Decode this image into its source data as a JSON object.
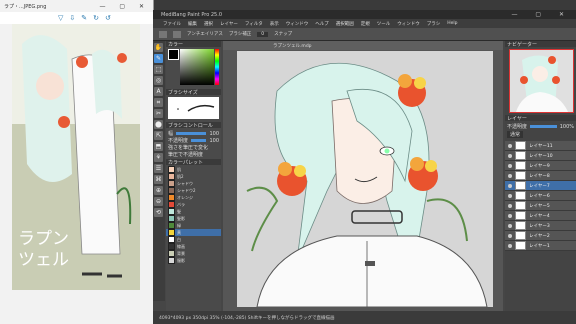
{
  "viewer": {
    "title": "ラプ・...JPEG.png",
    "tools": [
      "▽",
      "⇩",
      "✎",
      "↻",
      "↺"
    ],
    "poster_text": [
      "ラプン",
      "ツェル"
    ],
    "status_left": "",
    "status_right": ""
  },
  "app": {
    "title": "MediBang Paint Pro 25.0",
    "menu": [
      "ファイル",
      "編集",
      "選択",
      "レイヤー",
      "フィルタ",
      "表示",
      "ウィンドウ",
      "ヘルプ",
      "選択範囲",
      "定規",
      "ツール",
      "ウィンドウ",
      "ブラシ",
      "Help"
    ],
    "toolbar": {
      "antialias_label": "アンチエイリアス",
      "mode_label": "ブラシ補正",
      "value": "0",
      "snap_label": "スナップ"
    },
    "tab_label": "ラプンツェル.mdp",
    "tools": [
      "✋",
      "✎",
      "⬚",
      "◎",
      "A",
      "⌗",
      "✂",
      "⬤",
      "⇱",
      "⬒",
      "⚘",
      "☰",
      "⌘",
      "⊕",
      "⊖",
      "⟲"
    ],
    "color_panel": {
      "title": "カラー",
      "brush_size_title": "ブラシサイズ",
      "brush_control_title": "ブラシコントロール",
      "sliders": [
        {
          "label": "幅",
          "value": "100"
        },
        {
          "label": "不透明度",
          "value": "100"
        }
      ],
      "checks": [
        "強さを筆圧で変化",
        "筆圧で不透明度"
      ],
      "palette_title": "カラーパレット",
      "palette": [
        {
          "name": "肌",
          "color": "#f5d0b8"
        },
        {
          "name": "肌2",
          "color": "#e8b59c"
        },
        {
          "name": "シャドウ",
          "color": "#caa08a"
        },
        {
          "name": "シャドウ2",
          "color": "#8a6a5a"
        },
        {
          "name": "オレンジ",
          "color": "#f08a2a"
        },
        {
          "name": "バラ",
          "color": "#e24a38"
        },
        {
          "name": "髪",
          "color": "#bfe8dc"
        },
        {
          "name": "髪影",
          "color": "#8ec8b8"
        },
        {
          "name": "緑",
          "color": "#4f8a3a"
        },
        {
          "name": "黄",
          "color": "#f2d43a"
        },
        {
          "name": "白",
          "color": "#ffffff"
        },
        {
          "name": "線画",
          "color": "#333333"
        },
        {
          "name": "背景",
          "color": "#c9cdb4"
        },
        {
          "name": "服影",
          "color": "#d8d8d8"
        }
      ],
      "selected_palette": 9
    },
    "right_panel": {
      "navigator_title": "ナビゲーター",
      "layer_title": "レイヤー",
      "opacity_label": "不透明度",
      "opacity_value": "100%",
      "blend_label": "通常",
      "layers": [
        "レイヤー11",
        "レイヤー10",
        "レイヤー9",
        "レイヤー8",
        "レイヤー7",
        "レイヤー6",
        "レイヤー5",
        "レイヤー4",
        "レイヤー3",
        "レイヤー2",
        "レイヤー1"
      ],
      "selected_layer": 4
    },
    "status": "4093*4093 px 350dpi 35% (-104,-285)  Shiftキーを押しながらドラッグで直線描画",
    "accent": "#4a90d9"
  }
}
